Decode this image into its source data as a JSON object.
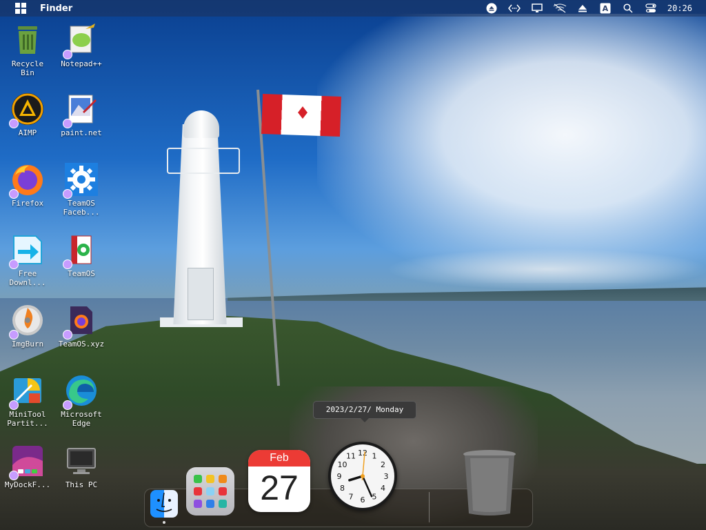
{
  "topbar": {
    "app_name": "Finder",
    "clock": "20:26",
    "icons": [
      "windows-icon",
      "eject-icon",
      "network-code-icon",
      "display-icon",
      "wifi-off-icon",
      "upload-icon",
      "input-method-icon",
      "search-icon",
      "control-center-icon"
    ],
    "input_method_label": "A"
  },
  "desktop_icons": [
    {
      "label": "Recycle\nBin",
      "icon": "recycle-bin-icon"
    },
    {
      "label": "Notepad++",
      "icon": "notepad-plus-plus-icon"
    },
    {
      "label": "AIMP",
      "icon": "aimp-icon"
    },
    {
      "label": "paint.net",
      "icon": "paint-net-icon"
    },
    {
      "label": "Firefox",
      "icon": "firefox-icon"
    },
    {
      "label": "TeamOS\nFaceb...",
      "icon": "gear-icon"
    },
    {
      "label": "Free\nDownl...",
      "icon": "free-download-icon"
    },
    {
      "label": "TeamOS",
      "icon": "teamos-icon"
    },
    {
      "label": "ImgBurn",
      "icon": "imgburn-icon"
    },
    {
      "label": "TeamOS.xyz",
      "icon": "teamos-firefox-icon"
    },
    {
      "label": "MiniTool\nPartit...",
      "icon": "minitool-partition-icon"
    },
    {
      "label": "Microsoft\nEdge",
      "icon": "edge-icon"
    },
    {
      "label": "MyDockF...",
      "icon": "mydockfinder-icon"
    },
    {
      "label": "This PC",
      "icon": "this-pc-icon"
    }
  ],
  "tooltip": {
    "text": "2023/2/27/ Monday"
  },
  "dock": {
    "items": [
      "finder-icon",
      "launchpad-icon",
      "calendar-icon",
      "clock-icon",
      "trash-icon"
    ],
    "calendar": {
      "month": "Feb",
      "day": "27"
    },
    "clock_numbers": [
      "12",
      "1",
      "2",
      "3",
      "4",
      "5",
      "6",
      "7",
      "8",
      "9",
      "10",
      "11"
    ],
    "clock_time": {
      "hour": 20,
      "minute": 26
    }
  },
  "colors": {
    "topbar": "#1e325a",
    "calendar_red": "#ec3b35",
    "shortcut_badge": "#c79cff"
  }
}
